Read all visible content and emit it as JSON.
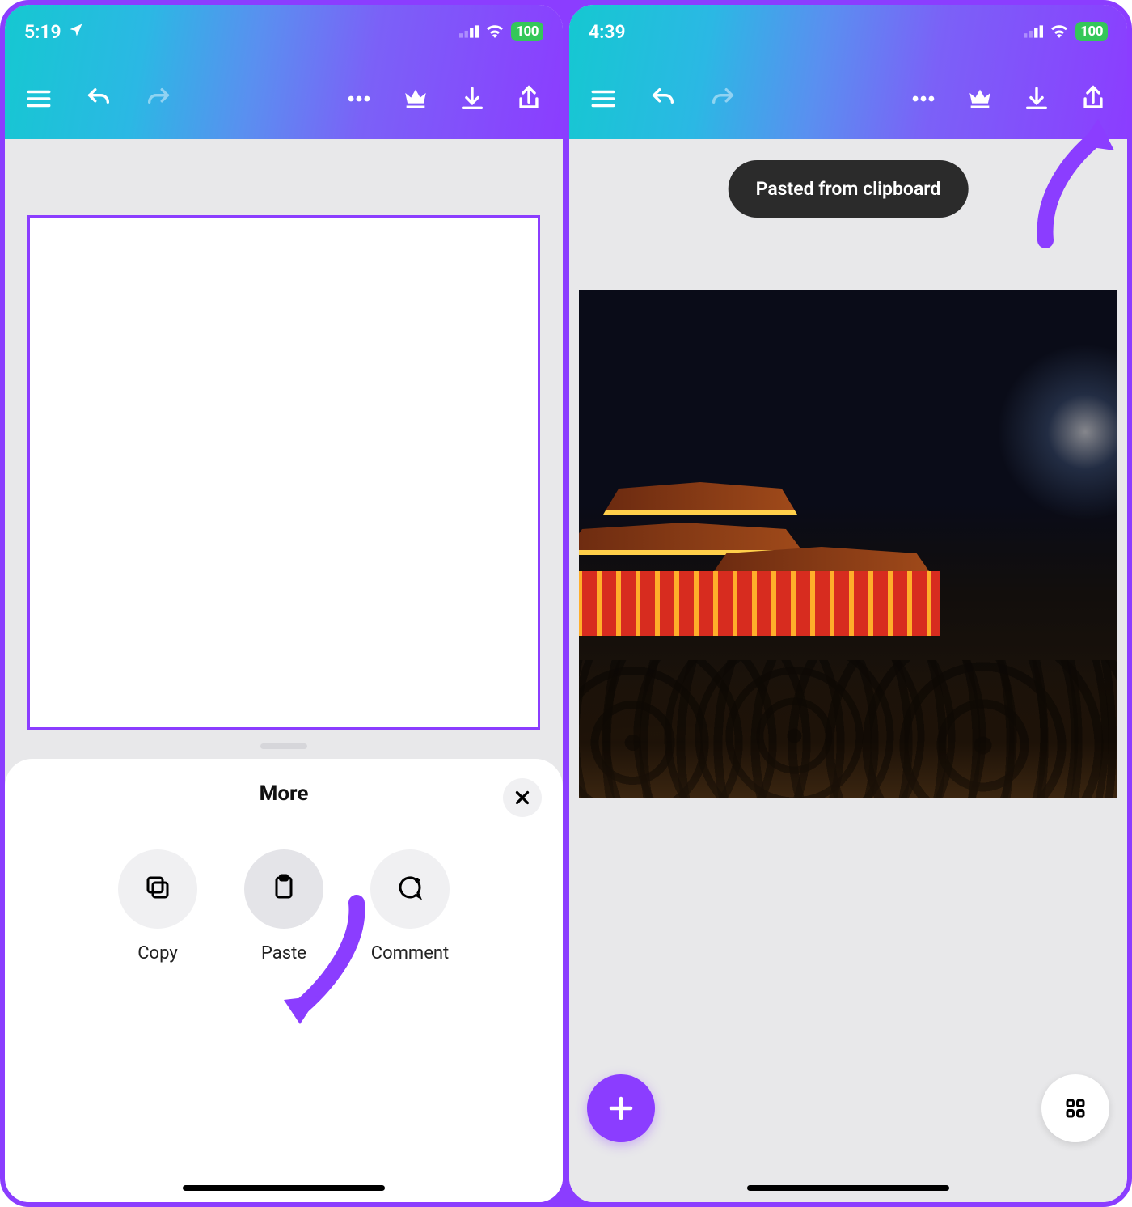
{
  "left": {
    "status": {
      "time": "5:19",
      "battery": "100"
    },
    "sheet": {
      "title": "More",
      "actions": [
        {
          "label": "Copy"
        },
        {
          "label": "Paste"
        },
        {
          "label": "Comment"
        }
      ]
    }
  },
  "right": {
    "status": {
      "time": "4:39",
      "battery": "100"
    },
    "toast": "Pasted from clipboard"
  }
}
